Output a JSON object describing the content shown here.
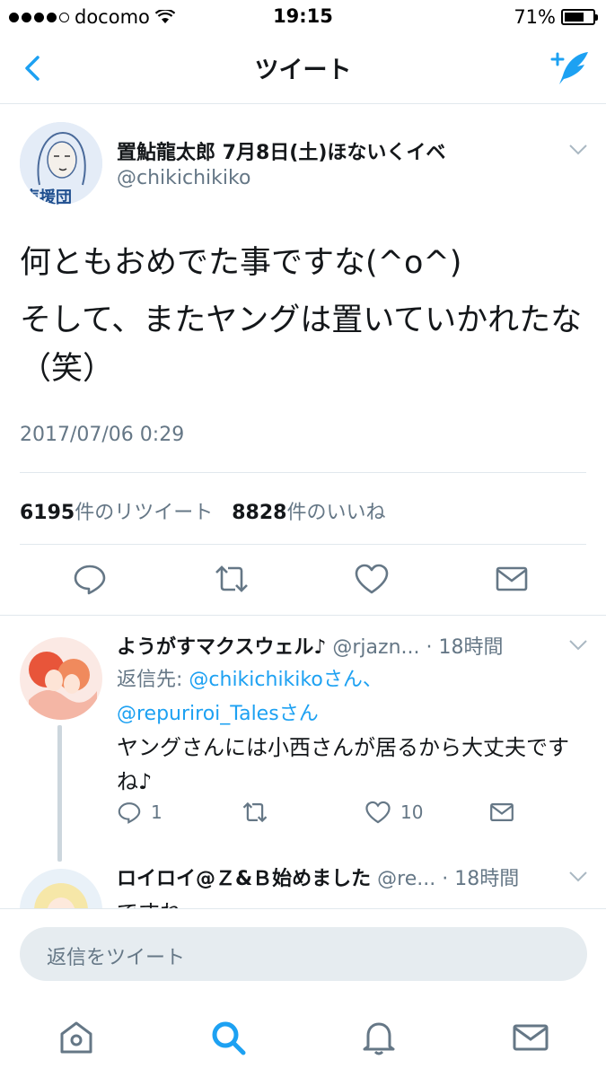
{
  "status_bar": {
    "carrier": "docomo",
    "time": "19:15",
    "battery": "71%",
    "battery_level": 0.71
  },
  "nav": {
    "title": "ツイート",
    "back_icon": "chevron-left-icon",
    "compose_icon": "compose-tweet-icon"
  },
  "tweet": {
    "author": "置鮎龍太郎 7月8日(土)ほないくイベ",
    "handle": "@chikichikiko",
    "avatar_text": "声援団",
    "text_line1": "何ともおめでた事ですな(^o^)",
    "text_line2": "そして、またヤングは置いていかれたな（笑）",
    "timestamp": "2017/07/06 0:29",
    "retweet_count": "6195",
    "retweet_label": "件のリツイート",
    "like_count": "8828",
    "like_label": "件のいいね"
  },
  "replies": [
    {
      "name": "ようがすマクスウェル♪",
      "meta": " @rjazn... · 18時間",
      "reply_to_prefix": "返信先: ",
      "mention1": "@chikichikiko",
      "mention1_suffix": "さん、",
      "mention2": "@repuriroi_Tales",
      "mention2_suffix": "さん",
      "body": "ヤングさんには小西さんが居るから大丈夫ですね♪",
      "reply_count": "1",
      "like_count": "10"
    },
    {
      "name": "ロイロイ@Ｚ&Ｂ始めました",
      "meta": " @re... · 18時間",
      "body": "ですねｗｗｗ"
    }
  ],
  "reply_box": {
    "placeholder": "返信をツイート"
  },
  "tabs": [
    "home-icon",
    "search-icon",
    "notifications-icon",
    "messages-icon"
  ],
  "colors": {
    "accent": "#1da1f2",
    "secondary_text": "#657786",
    "divider": "#e1e8ed"
  }
}
